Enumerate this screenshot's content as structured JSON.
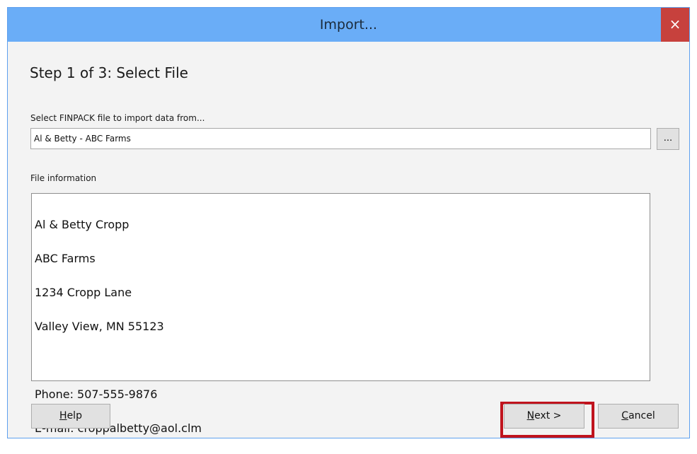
{
  "window": {
    "title": "Import...",
    "close_label": "×"
  },
  "step": {
    "title": "Step 1 of 3: Select File"
  },
  "file_select": {
    "label": "Select FINPACK file to import data from...",
    "value": "Al & Betty - ABC Farms",
    "browse_label": "..."
  },
  "file_info": {
    "label": "File information",
    "lines": [
      "Al & Betty Cropp",
      "ABC Farms",
      "1234 Cropp Lane",
      "Valley View, MN  55123",
      "",
      "Phone: 507-555-9876",
      "E-mail: croppalbetty@aol.clm"
    ]
  },
  "buttons": {
    "help_first": "H",
    "help_rest": "elp",
    "next_first": "N",
    "next_rest": "ext >",
    "cancel_first": "C",
    "cancel_rest": "ancel"
  },
  "colors": {
    "titlebar": "#6aadf7",
    "close": "#c7413d",
    "highlight": "#c0141e"
  }
}
